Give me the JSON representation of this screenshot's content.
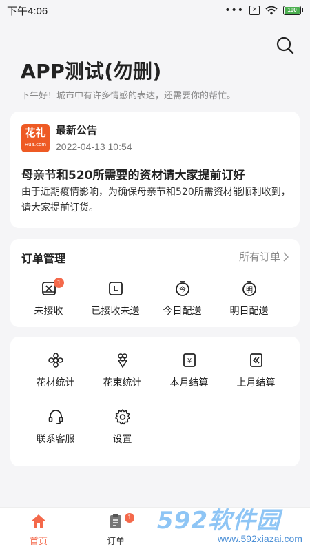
{
  "status": {
    "time": "下午4:06",
    "dots": "•••",
    "sim": "×",
    "battery": "100"
  },
  "header": {
    "title": "APP测试(勿删)",
    "greeting": "下午好！城市中有许多情感的表达，还需要你的帮忙。"
  },
  "announcement": {
    "logo_line1": "花礼",
    "logo_line2": "Hua.com",
    "label": "最新公告",
    "date": "2022-04-13 10:54",
    "headline": "母亲节和520所需要的资材请大家提前订好",
    "body": "由于近期疫情影响，为确保母亲节和520所需资材能顺利收到，请大家提前订货。"
  },
  "orders": {
    "title": "订单管理",
    "all_label": "所有订单",
    "items": [
      {
        "label": "未接收",
        "badge": "1"
      },
      {
        "label": "已接收未送"
      },
      {
        "label": "今日配送"
      },
      {
        "label": "明日配送"
      }
    ]
  },
  "tools": {
    "items": [
      {
        "label": "花材统计"
      },
      {
        "label": "花束统计"
      },
      {
        "label": "本月结算"
      },
      {
        "label": "上月结算"
      },
      {
        "label": "联系客服"
      },
      {
        "label": "设置"
      }
    ]
  },
  "tabbar": {
    "home": "首页",
    "orders": "订单",
    "orders_badge": "1"
  },
  "watermark": {
    "main": "592软件园",
    "url": "www.592xiazai.com"
  },
  "colors": {
    "accent": "#f4694b",
    "background": "#f5f5f7",
    "card": "#ffffff"
  }
}
